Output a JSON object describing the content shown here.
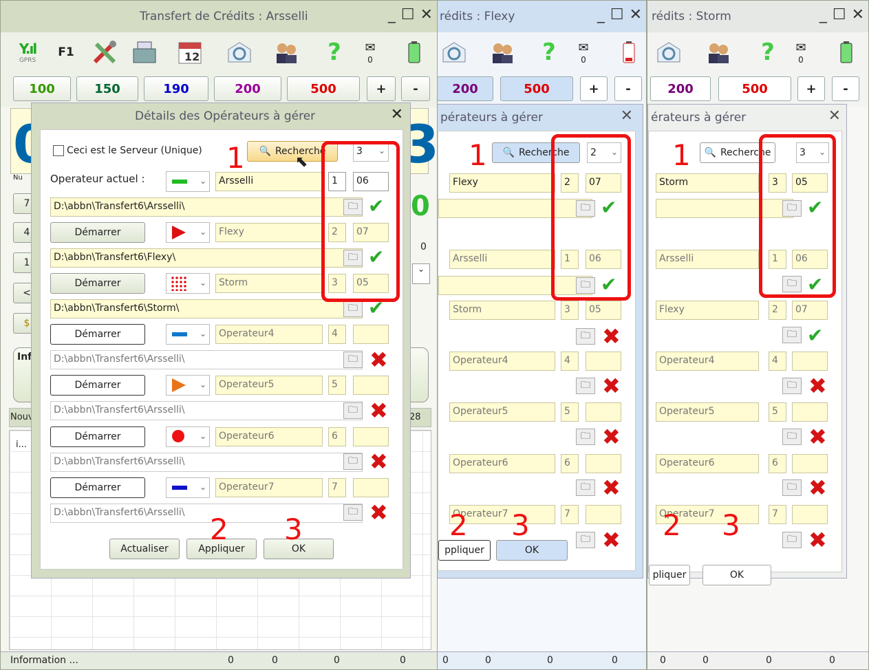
{
  "windows": [
    {
      "title": "Transfert de Crédits : Arsselli",
      "amount_buttons": [
        "100",
        "150",
        "190",
        "200",
        "500",
        "+",
        "-"
      ],
      "signal": "GPRS",
      "f1": "F1",
      "mail_count": "0",
      "status": {
        "info": "Information ...",
        "cells": [
          "0",
          "0",
          "0",
          "0"
        ]
      },
      "dialog": {
        "title": "Détails des Opérateurs à gérer",
        "server_checkbox": "Ceci est le Serveur (Unique)",
        "search_button": "Recherche",
        "search_count": "3",
        "current_label": "Operateur actuel :",
        "current_name": "Arsselli",
        "current_num": "1",
        "current_code": "06",
        "rows": [
          {
            "start": "Démarrer",
            "name": "Flexy",
            "num": "2",
            "code": "07",
            "path": "D:\\abbn\\Transfert6\\Flexy\\",
            "ok": true
          },
          {
            "start": "Démarrer",
            "name": "Storm",
            "num": "3",
            "code": "05",
            "path": "D:\\abbn\\Transfert6\\Storm\\",
            "ok": true
          },
          {
            "start": "Démarrer",
            "name": "Operateur4",
            "num": "4",
            "code": "",
            "path": "D:\\abbn\\Transfert6\\Arsselli\\",
            "ok": false
          },
          {
            "start": "Démarrer",
            "name": "Operateur5",
            "num": "5",
            "code": "",
            "path": "D:\\abbn\\Transfert6\\Arsselli\\",
            "ok": false
          },
          {
            "start": "Démarrer",
            "name": "Operateur6",
            "num": "6",
            "code": "",
            "path": "D:\\abbn\\Transfert6\\Arsselli\\",
            "ok": false
          },
          {
            "start": "Démarrer",
            "name": "Operateur7",
            "num": "7",
            "code": "",
            "path": "D:\\abbn\\Transfert6\\Arsselli\\",
            "ok": false
          }
        ],
        "current_path": "D:\\abbn\\Transfert6\\Arsselli\\",
        "actualiser": "Actualiser",
        "appliquer": "Appliquer",
        "ok": "OK"
      },
      "side_labels": {
        "nu": "Nu",
        "nouv": "Nouv",
        "inf": "Inf",
        "i": "i...",
        "n28": "28",
        "zero": "0",
        "big_digit_left": "0",
        "big_digit_right": "3",
        "green_digit": "0",
        "keys": [
          "7",
          "4",
          "1",
          "<"
        ]
      }
    },
    {
      "title": "rédits : Flexy",
      "amount_buttons": [
        "200",
        "500",
        "+",
        "-"
      ],
      "mail_count": "0",
      "status": {
        "cells": [
          "0",
          "0",
          "0",
          "0"
        ]
      },
      "dialog": {
        "title": "pérateurs à gérer",
        "search_button": "Recherche",
        "search_count": "2",
        "current_name": "Flexy",
        "current_num": "2",
        "current_code": "07",
        "rows": [
          {
            "name": "Arsselli",
            "num": "1",
            "code": "06",
            "ok": true
          },
          {
            "name": "Storm",
            "num": "3",
            "code": "05",
            "ok": false
          },
          {
            "name": "Operateur4",
            "num": "4",
            "code": "",
            "ok": false
          },
          {
            "name": "Operateur5",
            "num": "5",
            "code": "",
            "ok": false
          },
          {
            "name": "Operateur6",
            "num": "6",
            "code": "",
            "ok": false
          },
          {
            "name": "Operateur7",
            "num": "7",
            "code": "",
            "ok": false
          }
        ],
        "appliquer": "ppliquer",
        "ok": "OK"
      }
    },
    {
      "title": "rédits : Storm",
      "amount_buttons": [
        "200",
        "500",
        "+",
        "-"
      ],
      "mail_count": "0",
      "status": {
        "cells": [
          "0",
          "0",
          "0",
          "0"
        ]
      },
      "dialog": {
        "title": "érateurs à gérer",
        "search_button": "Recherche",
        "search_count": "3",
        "current_name": "Storm",
        "current_num": "3",
        "current_code": "05",
        "rows": [
          {
            "name": "Arsselli",
            "num": "1",
            "code": "06",
            "ok": true
          },
          {
            "name": "Flexy",
            "num": "2",
            "code": "07",
            "ok": true
          },
          {
            "name": "Operateur4",
            "num": "4",
            "code": "",
            "ok": false
          },
          {
            "name": "Operateur5",
            "num": "5",
            "code": "",
            "ok": false
          },
          {
            "name": "Operateur6",
            "num": "6",
            "code": "",
            "ok": false
          },
          {
            "name": "Operateur7",
            "num": "7",
            "code": "",
            "ok": false
          }
        ],
        "appliquer": "pliquer",
        "ok": "OK"
      }
    }
  ],
  "annotations": {
    "n1": "1",
    "n2": "2",
    "n3": "3"
  },
  "colors": {
    "win1_bg": "#d9dfcc",
    "win2_bg": "#cfe0f3",
    "win3_bg": "#e8e8e8",
    "red_annot": "#e11111"
  }
}
